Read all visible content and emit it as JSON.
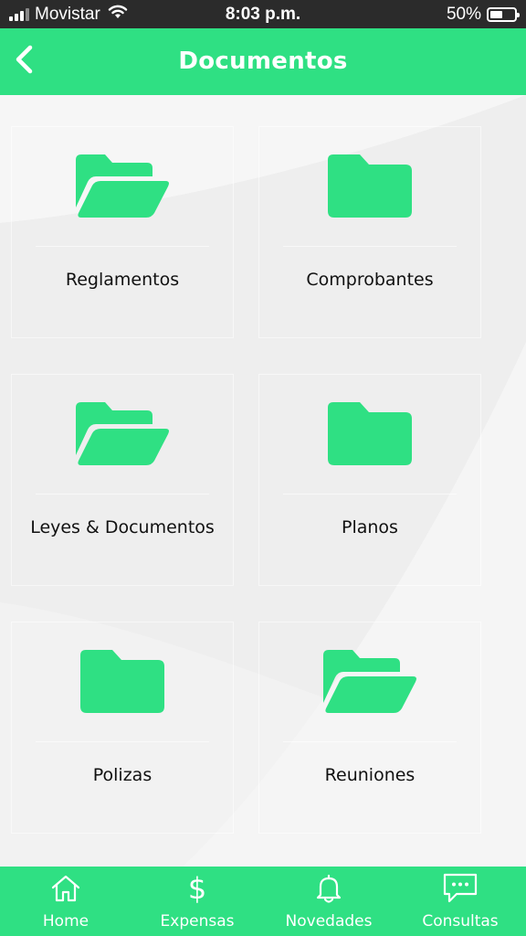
{
  "status_bar": {
    "carrier": "Movistar",
    "time": "8:03 p.m.",
    "battery": "50%",
    "battery_level": 0.5
  },
  "header": {
    "title": "Documentos",
    "back_icon": "chevron-left-icon"
  },
  "colors": {
    "accent": "#2fe083",
    "status_bar": "#2b2b2b",
    "background": "#ececec",
    "label_text": "#111111"
  },
  "folders": [
    {
      "label": "Reglamentos",
      "icon": "folder-open-icon"
    },
    {
      "label": "Comprobantes",
      "icon": "folder-icon"
    },
    {
      "label": "Leyes & Documentos",
      "icon": "folder-open-icon"
    },
    {
      "label": "Planos",
      "icon": "folder-icon"
    },
    {
      "label": "Polizas",
      "icon": "folder-icon"
    },
    {
      "label": "Reuniones",
      "icon": "folder-open-icon"
    }
  ],
  "bottom_nav": [
    {
      "label": "Home",
      "icon": "home-icon"
    },
    {
      "label": "Expensas",
      "icon": "dollar-icon",
      "glyph": "$"
    },
    {
      "label": "Novedades",
      "icon": "bell-icon"
    },
    {
      "label": "Consultas",
      "icon": "chat-icon"
    }
  ]
}
